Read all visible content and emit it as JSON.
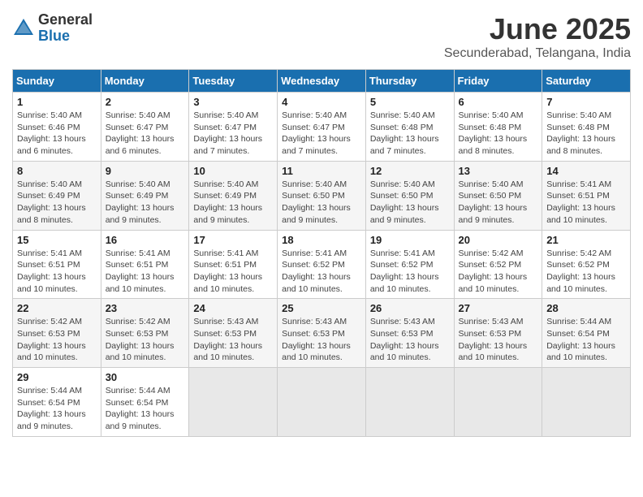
{
  "logo": {
    "general": "General",
    "blue": "Blue"
  },
  "title": "June 2025",
  "location": "Secunderabad, Telangana, India",
  "weekdays": [
    "Sunday",
    "Monday",
    "Tuesday",
    "Wednesday",
    "Thursday",
    "Friday",
    "Saturday"
  ],
  "weeks": [
    [
      {
        "day": "1",
        "info": "Sunrise: 5:40 AM\nSunset: 6:46 PM\nDaylight: 13 hours\nand 6 minutes."
      },
      {
        "day": "2",
        "info": "Sunrise: 5:40 AM\nSunset: 6:47 PM\nDaylight: 13 hours\nand 6 minutes."
      },
      {
        "day": "3",
        "info": "Sunrise: 5:40 AM\nSunset: 6:47 PM\nDaylight: 13 hours\nand 7 minutes."
      },
      {
        "day": "4",
        "info": "Sunrise: 5:40 AM\nSunset: 6:47 PM\nDaylight: 13 hours\nand 7 minutes."
      },
      {
        "day": "5",
        "info": "Sunrise: 5:40 AM\nSunset: 6:48 PM\nDaylight: 13 hours\nand 7 minutes."
      },
      {
        "day": "6",
        "info": "Sunrise: 5:40 AM\nSunset: 6:48 PM\nDaylight: 13 hours\nand 8 minutes."
      },
      {
        "day": "7",
        "info": "Sunrise: 5:40 AM\nSunset: 6:48 PM\nDaylight: 13 hours\nand 8 minutes."
      }
    ],
    [
      {
        "day": "8",
        "info": "Sunrise: 5:40 AM\nSunset: 6:49 PM\nDaylight: 13 hours\nand 8 minutes."
      },
      {
        "day": "9",
        "info": "Sunrise: 5:40 AM\nSunset: 6:49 PM\nDaylight: 13 hours\nand 9 minutes."
      },
      {
        "day": "10",
        "info": "Sunrise: 5:40 AM\nSunset: 6:49 PM\nDaylight: 13 hours\nand 9 minutes."
      },
      {
        "day": "11",
        "info": "Sunrise: 5:40 AM\nSunset: 6:50 PM\nDaylight: 13 hours\nand 9 minutes."
      },
      {
        "day": "12",
        "info": "Sunrise: 5:40 AM\nSunset: 6:50 PM\nDaylight: 13 hours\nand 9 minutes."
      },
      {
        "day": "13",
        "info": "Sunrise: 5:40 AM\nSunset: 6:50 PM\nDaylight: 13 hours\nand 9 minutes."
      },
      {
        "day": "14",
        "info": "Sunrise: 5:41 AM\nSunset: 6:51 PM\nDaylight: 13 hours\nand 10 minutes."
      }
    ],
    [
      {
        "day": "15",
        "info": "Sunrise: 5:41 AM\nSunset: 6:51 PM\nDaylight: 13 hours\nand 10 minutes."
      },
      {
        "day": "16",
        "info": "Sunrise: 5:41 AM\nSunset: 6:51 PM\nDaylight: 13 hours\nand 10 minutes."
      },
      {
        "day": "17",
        "info": "Sunrise: 5:41 AM\nSunset: 6:51 PM\nDaylight: 13 hours\nand 10 minutes."
      },
      {
        "day": "18",
        "info": "Sunrise: 5:41 AM\nSunset: 6:52 PM\nDaylight: 13 hours\nand 10 minutes."
      },
      {
        "day": "19",
        "info": "Sunrise: 5:41 AM\nSunset: 6:52 PM\nDaylight: 13 hours\nand 10 minutes."
      },
      {
        "day": "20",
        "info": "Sunrise: 5:42 AM\nSunset: 6:52 PM\nDaylight: 13 hours\nand 10 minutes."
      },
      {
        "day": "21",
        "info": "Sunrise: 5:42 AM\nSunset: 6:52 PM\nDaylight: 13 hours\nand 10 minutes."
      }
    ],
    [
      {
        "day": "22",
        "info": "Sunrise: 5:42 AM\nSunset: 6:53 PM\nDaylight: 13 hours\nand 10 minutes."
      },
      {
        "day": "23",
        "info": "Sunrise: 5:42 AM\nSunset: 6:53 PM\nDaylight: 13 hours\nand 10 minutes."
      },
      {
        "day": "24",
        "info": "Sunrise: 5:43 AM\nSunset: 6:53 PM\nDaylight: 13 hours\nand 10 minutes."
      },
      {
        "day": "25",
        "info": "Sunrise: 5:43 AM\nSunset: 6:53 PM\nDaylight: 13 hours\nand 10 minutes."
      },
      {
        "day": "26",
        "info": "Sunrise: 5:43 AM\nSunset: 6:53 PM\nDaylight: 13 hours\nand 10 minutes."
      },
      {
        "day": "27",
        "info": "Sunrise: 5:43 AM\nSunset: 6:53 PM\nDaylight: 13 hours\nand 10 minutes."
      },
      {
        "day": "28",
        "info": "Sunrise: 5:44 AM\nSunset: 6:54 PM\nDaylight: 13 hours\nand 10 minutes."
      }
    ],
    [
      {
        "day": "29",
        "info": "Sunrise: 5:44 AM\nSunset: 6:54 PM\nDaylight: 13 hours\nand 9 minutes."
      },
      {
        "day": "30",
        "info": "Sunrise: 5:44 AM\nSunset: 6:54 PM\nDaylight: 13 hours\nand 9 minutes."
      },
      {
        "day": "",
        "info": ""
      },
      {
        "day": "",
        "info": ""
      },
      {
        "day": "",
        "info": ""
      },
      {
        "day": "",
        "info": ""
      },
      {
        "day": "",
        "info": ""
      }
    ]
  ]
}
